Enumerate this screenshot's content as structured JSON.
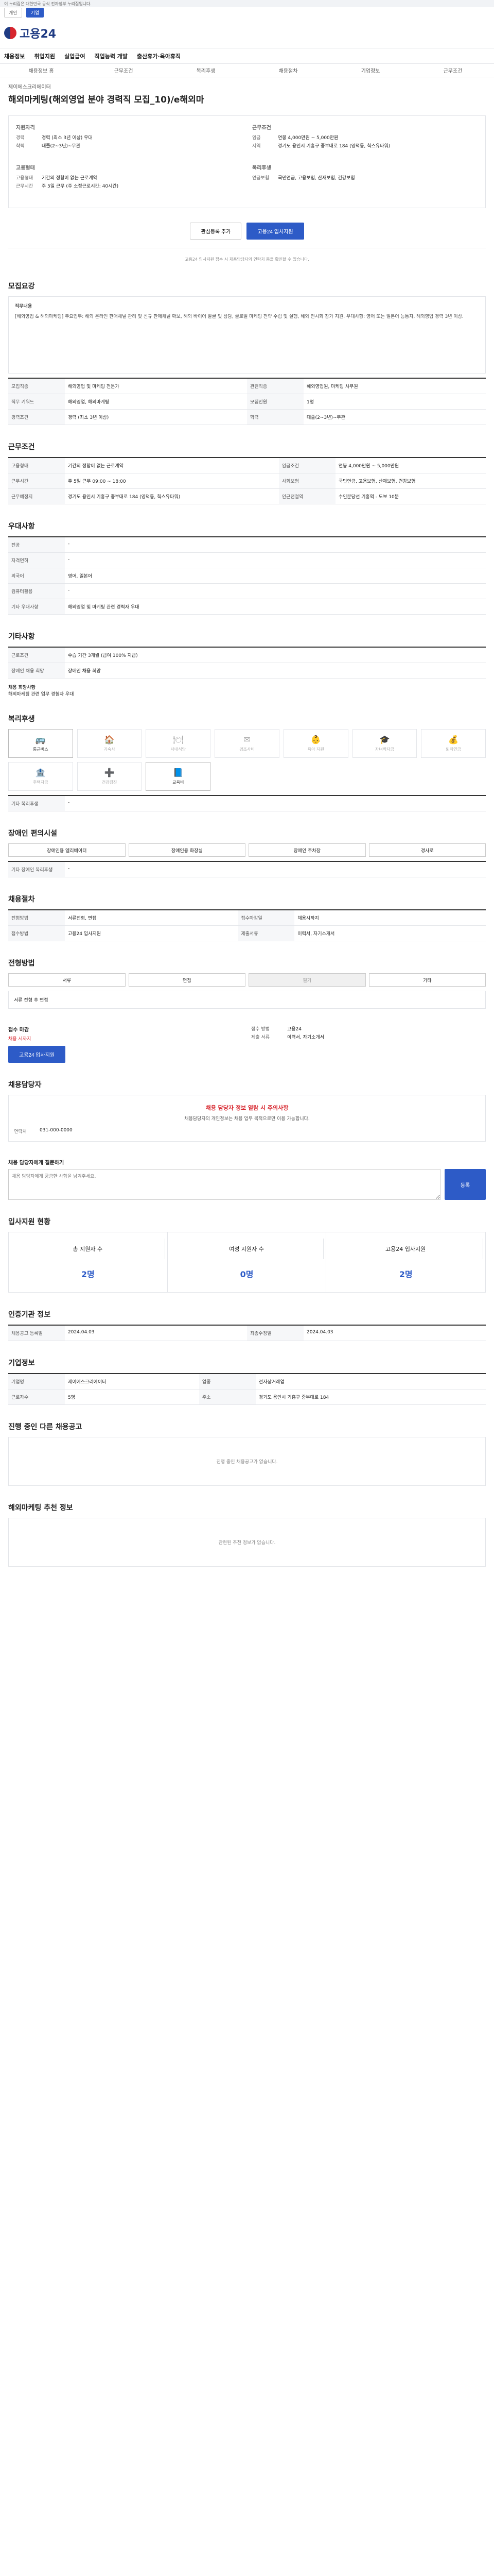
{
  "gov_bar": {
    "text": "이 누리집은 대한민국 공식 전자정부 누리집입니다."
  },
  "org_tabs": [
    "개인",
    "기업"
  ],
  "brand": {
    "name": "고용24"
  },
  "nav": [
    "채용정보",
    "취업지원",
    "실업급여",
    "직업능력 개발",
    "출산휴가·육아휴직"
  ],
  "subnav": [
    "채용정보 홈",
    "근무조건",
    "복리후생",
    "채용절차",
    "기업정보",
    "근무조건"
  ],
  "job": {
    "company": "제이에스크리에이터",
    "title": "해외마케팅(해외영업 분야 경력직 모집_10)/e해외마"
  },
  "summary": {
    "left_heading": "지원자격",
    "left": [
      {
        "k": "경력",
        "v": "경력 (최소 3년 이상) 우대"
      },
      {
        "k": "학력",
        "v": "대졸(2~3년)~무관"
      }
    ],
    "right_heading": "근무조건",
    "right": [
      {
        "k": "임금",
        "v": "연봉 4,000만원 ~ 5,000만원"
      },
      {
        "k": "지역",
        "v": "경기도 용인시 기흥구 중부대로 184 (영덕동, 힉스유타워)"
      }
    ],
    "left2_heading": "고용형태",
    "left2": [
      {
        "k": "고용형태",
        "v": "기간의 정함이 없는 근로계약"
      },
      {
        "k": "근무시간",
        "v": "주 5일 근무 (주 소정근로시간: 40시간)"
      }
    ],
    "right2_heading": "복리후생",
    "right2": [
      {
        "k": "연금보험",
        "v": "국민연금, 고용보험, 산재보험, 건강보험"
      }
    ]
  },
  "actions": {
    "bookmark": "관심등록 추가",
    "apply": "고용24 입사지원"
  },
  "notice": "고용24 입사지원 접수 시 채용담당자의 연락처 등을 확인할 수 있습니다.",
  "detail": {
    "title": "모집요강",
    "job_desc_title": "직무내용",
    "job_desc": "[해외영업 & 해외마케팅] 주요업무: 해외 온라인 판매채널 관리 및 신규 판매채널 확보, 해외 바이어 발굴 및 상담, 글로벌 마케팅 전략 수립 및 실행, 해외 전시회 참가 지원. 우대사항: 영어 또는 일본어 능통자, 해외영업 경력 3년 이상.",
    "rows": [
      {
        "k": "모집직종",
        "v": "해외영업 및 마케팅 전문가"
      },
      {
        "k": "관련직종",
        "v": "해외영업원, 마케팅 사무원"
      },
      {
        "k": "직무 키워드",
        "v": "해외영업, 해외마케팅"
      },
      {
        "k": "모집인원",
        "v": "1명"
      },
      {
        "k": "경력조건",
        "v": "경력 (최소 3년 이상)"
      },
      {
        "k": "학력",
        "v": "대졸(2~3년)~무관"
      }
    ]
  },
  "conditions": {
    "title": "근무조건",
    "rows": [
      {
        "k": "고용형태",
        "v": "기간의 정함이 없는 근로계약"
      },
      {
        "k": "임금조건",
        "v": "연봉 4,000만원 ~ 5,000만원"
      },
      {
        "k": "근무시간",
        "v": "주 5일 근무 09:00 ~ 18:00"
      },
      {
        "k": "사회보험",
        "v": "국민연금, 고용보험, 산재보험, 건강보험"
      },
      {
        "k": "근무예정지",
        "v": "경기도 용인시 기흥구 중부대로 184 (영덕동, 힉스유타워)"
      },
      {
        "k": "인근전철역",
        "v": "수인분당선 기흥역 - 도보 10분"
      }
    ]
  },
  "quals": {
    "title": "우대사항",
    "rows": [
      {
        "k": "전공",
        "v": "-"
      },
      {
        "k": "자격면허",
        "v": "-"
      },
      {
        "k": "외국어",
        "v": "영어, 일본어"
      },
      {
        "k": "컴퓨터활용",
        "v": "-"
      },
      {
        "k": "기타 우대사항",
        "v": "해외영업 및 마케팅 관련 경력자 우대"
      }
    ]
  },
  "etc": {
    "title": "기타사항",
    "rows": [
      {
        "k": "근로조건",
        "v": "수습 기간 3개월 (급여 100% 지급)"
      },
      {
        "k": "장애인 채용 희망",
        "v": "장애인 채용 희망"
      }
    ],
    "extra_title": "채용 희망사항",
    "extra": "해외마케팅 관련 업무 경험자 우대"
  },
  "welfare": {
    "title": "복리후생",
    "items": [
      "통근버스",
      "기숙사",
      "사내식당",
      "경조사비",
      "육아 지원",
      "자녀학자금",
      "퇴직연금",
      "주택자금",
      "건강검진",
      "교육비"
    ],
    "active": [
      0,
      9
    ],
    "etc_label": "기타 복리후생",
    "etc_value": "-"
  },
  "accessibility": {
    "title": "장애인 편의시설",
    "items": [
      "장애인용 엘리베이터",
      "장애인용 화장실",
      "장애인 주차장",
      "경사로"
    ],
    "etc_label": "기타 장애인 복리후생",
    "etc_value": "-"
  },
  "process": {
    "title": "채용절차",
    "rows": [
      {
        "k": "전형방법",
        "v": "서류전형, 면접"
      },
      {
        "k": "접수마감일",
        "v": "채용시까지"
      },
      {
        "k": "접수방법",
        "v": "고용24 입사지원"
      },
      {
        "k": "제출서류",
        "v": "이력서, 자기소개서"
      }
    ]
  },
  "channels": {
    "title": "전형방법",
    "tabs": [
      "서류",
      "면접",
      "필기",
      "기타"
    ],
    "note": "서류 전형 후 면접"
  },
  "apply": {
    "title": "접수 마감",
    "deadline_label": "채용 시까지",
    "method_label": "접수 방법",
    "method": "고용24",
    "documents_label": "제출 서류",
    "documents": "이력서, 자기소개서",
    "button": "고용24 입사지원"
  },
  "contact": {
    "title": "채용담당자",
    "warn": "채용 담당자 정보 열람 시 주의사항",
    "desc": "채용담당자의 개인정보는 채용 업무 목적으로만 이용 가능합니다.",
    "phone_label": "연락처",
    "phone": "031-000-0000"
  },
  "inquiry": {
    "title": "채용 담당자에게 질문하기",
    "placeholder": "채용 담당자에게 궁금한 사항을 남겨주세요.",
    "submit": "등록"
  },
  "stats": {
    "title": "입사지원 현황",
    "items": [
      {
        "label": "총 지원자 수",
        "value": "2명"
      },
      {
        "label": "여성 지원자 수",
        "value": "0명"
      },
      {
        "label": "고용24 입사지원",
        "value": "2명"
      }
    ]
  },
  "meta": {
    "title": "인증기관 정보",
    "rows": [
      {
        "k": "채용공고 등록일",
        "v": "2024.04.03"
      },
      {
        "k": "최종수정일",
        "v": "2024.04.03"
      }
    ]
  },
  "company": {
    "title": "기업정보",
    "rows": [
      {
        "k": "기업명",
        "v": "제이에스크리에이터"
      },
      {
        "k": "업종",
        "v": "전자상거래업"
      },
      {
        "k": "근로자수",
        "v": "5명"
      },
      {
        "k": "주소",
        "v": "경기도 용인시 기흥구 중부대로 184"
      }
    ]
  },
  "other_jobs": {
    "title": "진행 중인 다른 채용공고",
    "empty": "진행 중인 채용공고가 없습니다."
  },
  "recommend": {
    "title": "해외마케팅 추천 정보",
    "empty": "관련된 추천 정보가 없습니다."
  }
}
